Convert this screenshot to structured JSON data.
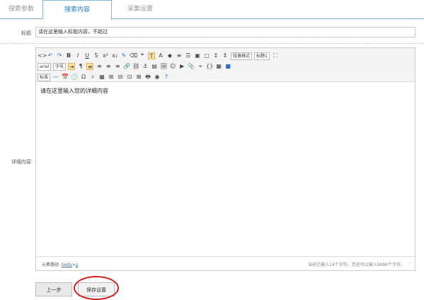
{
  "tabs": [
    {
      "label": "搜索参数"
    },
    {
      "label": "搜索内容"
    },
    {
      "label": "采集设置"
    }
  ],
  "form": {
    "title_label": "标题",
    "title_value": "请在这里输入标题内容，不超过",
    "content_label": "详细内容"
  },
  "toolbar": {
    "font_size_select": "字号",
    "font_family_select": "arial",
    "font_sub_select": "标准",
    "paragraph_select": "段落格式",
    "heading_select": "标题1"
  },
  "editor": {
    "content_text": "请在这里输入您的详细内容",
    "path_label": "元素路径:",
    "path_body": "body",
    "path_sep": ">",
    "path_p": "p",
    "word_count": "当前已输入14个字符，您还可以输入9986个字符。"
  },
  "buttons": {
    "prev": "上一步",
    "save": "保存设置"
  }
}
